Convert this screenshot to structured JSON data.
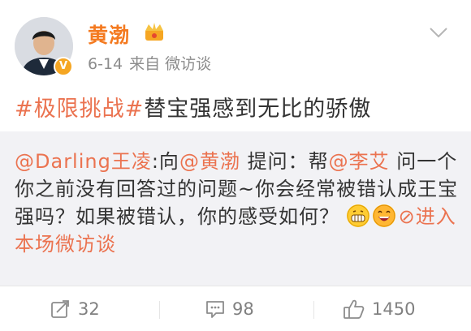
{
  "user": {
    "name": "黄渤",
    "verified_badge": "V"
  },
  "post": {
    "date": "6-14",
    "source": "来自 微访谈",
    "topic1": "#极限挑战#",
    "text": "替宝强感到无比的骄傲"
  },
  "repost": {
    "handle": "@Darling王凌",
    "text1": ":向",
    "mention1": "@黄渤",
    "text2": " 提问：帮",
    "mention2": "@李艾",
    "text3": " 问一个你之前没有回答过的问题~你会经常被错认成王宝强吗？如果被错认，你的感受如何？",
    "link_icon": "⊘",
    "link_text": "进入本场微访谈"
  },
  "toolbar": {
    "repost_count": "32",
    "comment_count": "98",
    "like_count": "1450"
  },
  "colors": {
    "name": "#f47a20",
    "link": "#eb7350",
    "repost_bg": "#f2f2f5"
  },
  "icons": {
    "crown": "crown-icon",
    "chevron": "chevron-down-icon",
    "repost": "repost-icon",
    "comment": "comment-icon",
    "like": "thumbs-up-icon"
  }
}
